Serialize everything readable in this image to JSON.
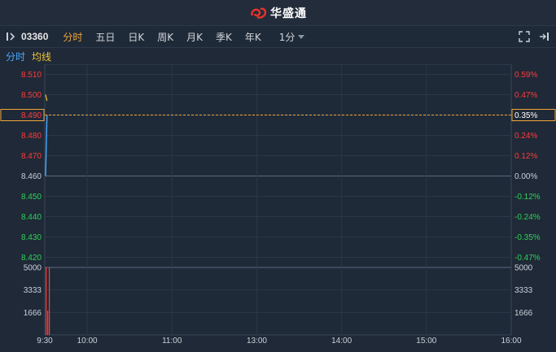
{
  "app": {
    "brand": "华盛通"
  },
  "toolbar": {
    "code": "03360",
    "tabs": [
      {
        "label": "分时",
        "active": true
      },
      {
        "label": "五日",
        "active": false
      },
      {
        "label": "日K",
        "active": false
      },
      {
        "label": "周K",
        "active": false
      },
      {
        "label": "月K",
        "active": false
      },
      {
        "label": "季K",
        "active": false
      },
      {
        "label": "年K",
        "active": false
      }
    ],
    "interval": "1分"
  },
  "legend": {
    "timeshare": "分时",
    "average": "均线"
  },
  "colors": {
    "up": "#ff3b3b",
    "down": "#2fd159",
    "flat": "#c9d1d9",
    "price_line": "#4aa8ff",
    "avg_line": "#f0c43a",
    "ref_dashed": "#f0a63a"
  },
  "chart_data": {
    "type": "line",
    "price_axis": {
      "ylim": [
        8.415,
        8.515
      ],
      "ticks": [
        "8.510",
        "8.500",
        "8.490",
        "8.480",
        "8.470",
        "8.460",
        "8.450",
        "8.440",
        "8.430",
        "8.420"
      ],
      "tick_values": [
        8.51,
        8.5,
        8.49,
        8.48,
        8.47,
        8.46,
        8.45,
        8.44,
        8.43,
        8.42
      ],
      "base": 8.46
    },
    "pct_axis": {
      "ticks": [
        "0.59%",
        "0.47%",
        "0.35%",
        "0.24%",
        "0.12%",
        "0.00%",
        "-0.12%",
        "-0.24%",
        "-0.35%",
        "-0.47%"
      ]
    },
    "current_price": "8.490",
    "current_pct": "0.35%",
    "volume_axis": {
      "ylim": [
        0,
        5000
      ],
      "ticks": [
        "5000",
        "3333",
        "1666"
      ],
      "tick_values": [
        5000,
        3333,
        1666
      ]
    },
    "x_axis": {
      "labels": [
        "9:30",
        "10:00",
        "11:00",
        "13:00",
        "14:00",
        "15:00",
        "16:00"
      ],
      "minutes": [
        0,
        30,
        90,
        150,
        210,
        270,
        330
      ]
    },
    "price_series": [
      {
        "t": 0,
        "v": 8.46
      },
      {
        "t": 0.5,
        "v": 8.475
      },
      {
        "t": 1,
        "v": 8.49
      }
    ],
    "avg_series": [
      {
        "t": 0,
        "v": 8.5
      },
      {
        "t": 1,
        "v": 8.497
      }
    ],
    "volume_bars": [
      {
        "t": 0,
        "v": 5000
      },
      {
        "t": 1,
        "v": 1800
      },
      {
        "t": 2,
        "v": 5000
      }
    ]
  }
}
